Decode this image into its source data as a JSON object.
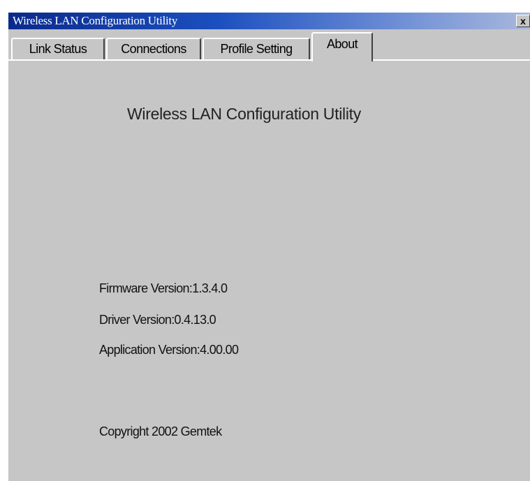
{
  "window": {
    "title": "Wireless LAN Configuration Utility",
    "close_label": "x"
  },
  "tabs": [
    {
      "label": "Link Status"
    },
    {
      "label": "Connections"
    },
    {
      "label": "Profile Setting"
    },
    {
      "label": "About"
    }
  ],
  "about": {
    "heading": "Wireless LAN Configuration Utility",
    "firmware_version": "Firmware Version:1.3.4.0",
    "driver_version": "Driver Version:0.4.13.0",
    "application_version": "Application Version:4.00.00",
    "copyright": "Copyright 2002 Gemtek"
  }
}
